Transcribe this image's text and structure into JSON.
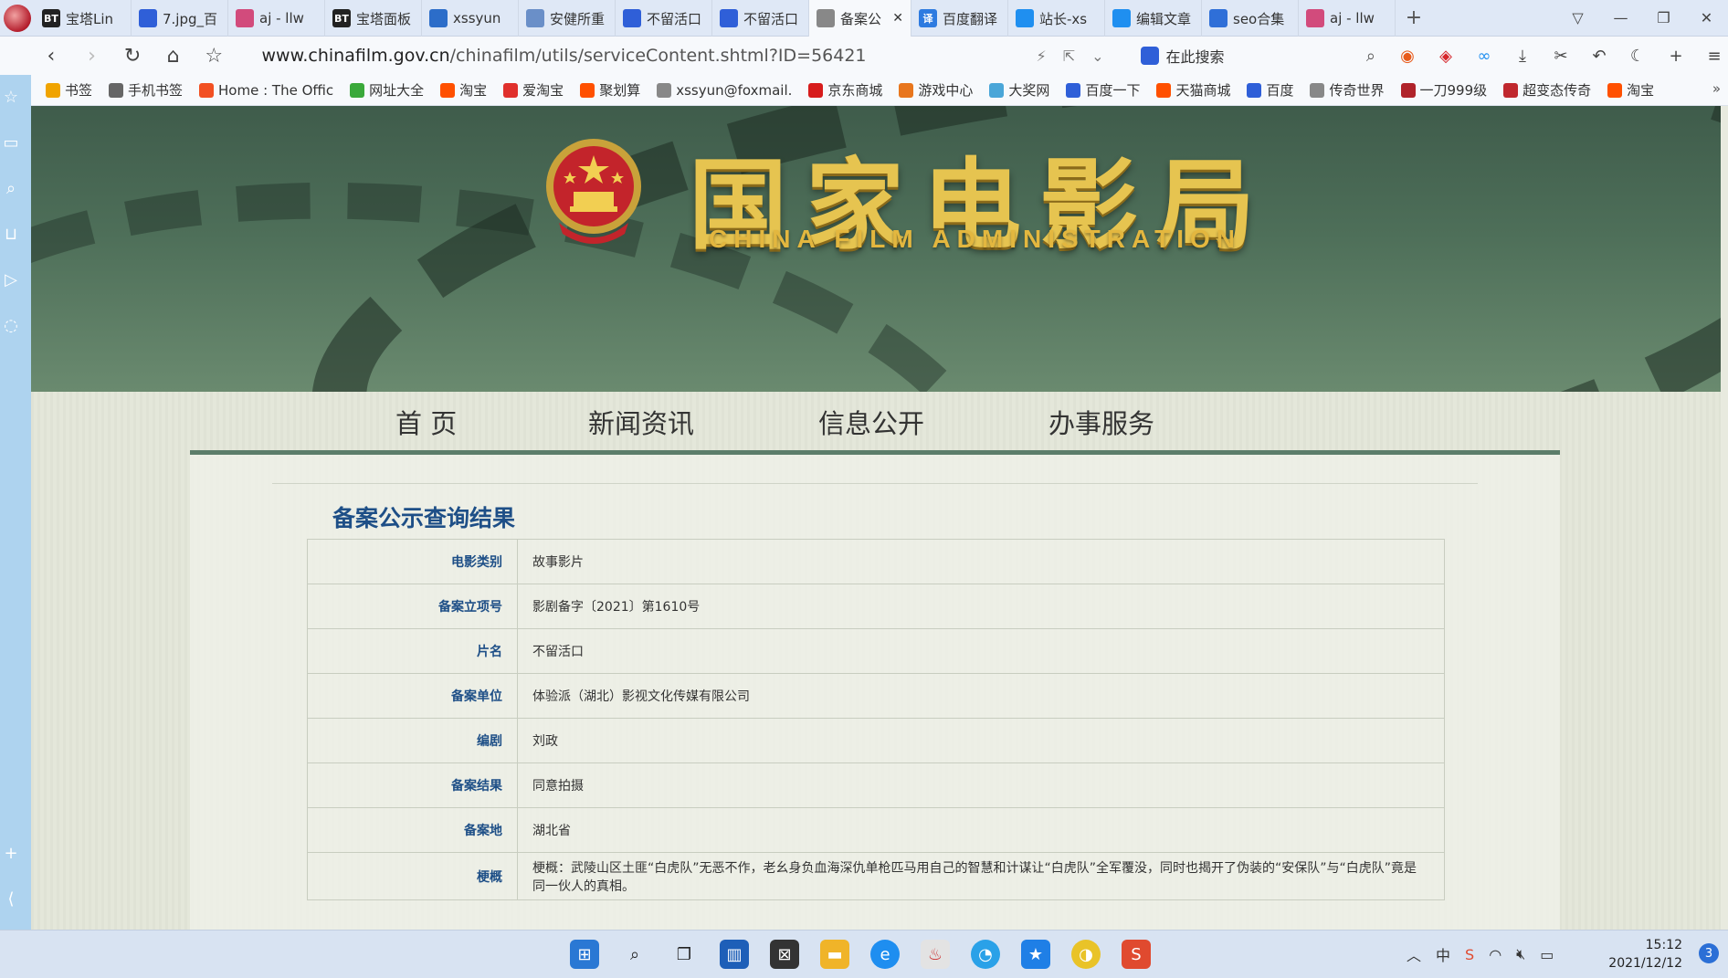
{
  "tabs": [
    {
      "label": "宝塔Lin",
      "icon": "bt-icon",
      "icon_text": "BT",
      "color": "#222222"
    },
    {
      "label": "7.jpg_百",
      "icon": "baidu-paw-icon",
      "icon_text": "",
      "color": "#2f5fd8"
    },
    {
      "label": "aj - llw",
      "icon": "colorful-a-icon",
      "icon_text": "",
      "color": "#d24b7c"
    },
    {
      "label": "宝塔面板",
      "icon": "bt-icon",
      "icon_text": "BT",
      "color": "#222222"
    },
    {
      "label": "xssyun",
      "icon": "w-icon",
      "icon_text": "",
      "color": "#2c6dc9"
    },
    {
      "label": "安健所重",
      "icon": "doc-icon",
      "icon_text": "",
      "color": "#6a8fc8"
    },
    {
      "label": "不留活口",
      "icon": "baidu-paw-icon",
      "icon_text": "",
      "color": "#2f5fd8"
    },
    {
      "label": "不留活口",
      "icon": "baidu-paw-icon",
      "icon_text": "",
      "color": "#2f5fd8"
    },
    {
      "label": "备案公",
      "icon": "globe-icon",
      "icon_text": "",
      "color": "#888888",
      "active": true
    },
    {
      "label": "百度翻译",
      "icon": "translate-icon",
      "icon_text": "译",
      "color": "#2e7be0"
    },
    {
      "label": "站长-xs",
      "icon": "blue-square-icon",
      "icon_text": "",
      "color": "#1f8ff0"
    },
    {
      "label": "编辑文章",
      "icon": "blue-square-icon",
      "icon_text": "",
      "color": "#1f8ff0"
    },
    {
      "label": "seo合集",
      "icon": "seo-icon",
      "icon_text": "",
      "color": "#2f6fd8"
    },
    {
      "label": "aj - llw",
      "icon": "colorful-a-icon",
      "icon_text": "",
      "color": "#d24b7c"
    }
  ],
  "address": {
    "host": "www.chinafilm.gov.cn",
    "path": "/chinafilm/utils/serviceContent.shtml?ID=56421",
    "search_placeholder": "在此搜索"
  },
  "bookmarks": [
    {
      "label": "书签",
      "icon": "star-icon",
      "color": "#f0a400"
    },
    {
      "label": "手机书签",
      "icon": "phone-icon",
      "color": "#666666"
    },
    {
      "label": "Home : The Offic",
      "icon": "microsoft-icon",
      "color": "#f25022"
    },
    {
      "label": "网址大全",
      "icon": "hao-icon",
      "color": "#3aa93a"
    },
    {
      "label": "淘宝",
      "icon": "taobao-icon",
      "color": "#ff5000"
    },
    {
      "label": "爱淘宝",
      "icon": "taobao-icon",
      "color": "#e0302c"
    },
    {
      "label": "聚划算",
      "icon": "taobao-icon",
      "color": "#ff5000"
    },
    {
      "label": "xssyun@foxmail.",
      "icon": "globe-icon",
      "color": "#888888"
    },
    {
      "label": "京东商城",
      "icon": "jd-icon",
      "color": "#d71c1c"
    },
    {
      "label": "游戏中心",
      "icon": "gamepad-icon",
      "color": "#e8761d"
    },
    {
      "label": "大奖网",
      "icon": "star-icon",
      "color": "#4aa6d8"
    },
    {
      "label": "百度一下",
      "icon": "baidu-paw-icon",
      "color": "#2f5fd8"
    },
    {
      "label": "天猫商城",
      "icon": "taobao-icon",
      "color": "#ff5000"
    },
    {
      "label": "百度",
      "icon": "baidu-paw-icon",
      "color": "#2f5fd8"
    },
    {
      "label": "传奇世界",
      "icon": "globe-icon",
      "color": "#888888"
    },
    {
      "label": "一刀999级",
      "icon": "game-icon",
      "color": "#b0232a"
    },
    {
      "label": "超变态传奇",
      "icon": "game-icon",
      "color": "#c0282e"
    },
    {
      "label": "淘宝",
      "icon": "taobao-icon",
      "color": "#ff5000"
    }
  ],
  "banner": {
    "title": "国家电影局",
    "subtitle": "CHINA FILM ADMINISTRATION"
  },
  "main_nav": [
    "首 页",
    "新闻资讯",
    "信息公开",
    "办事服务"
  ],
  "result": {
    "title": "备案公示查询结果",
    "rows": [
      {
        "key": "电影类别",
        "value": "故事影片"
      },
      {
        "key": "备案立项号",
        "value": "影剧备字〔2021〕第1610号"
      },
      {
        "key": "片名",
        "value": "不留活口"
      },
      {
        "key": "备案单位",
        "value": "体验派（湖北）影视文化传媒有限公司"
      },
      {
        "key": "编剧",
        "value": "刘政"
      },
      {
        "key": "备案结果",
        "value": "同意拍摄"
      },
      {
        "key": "备案地",
        "value": "湖北省"
      },
      {
        "key": "梗概",
        "value": "梗概：武陵山区土匪“白虎队”无恶不作，老幺身负血海深仇单枪匹马用自己的智慧和计谋让“白虎队”全军覆没，同时也揭开了伪装的“安保队”与“白虎队”竟是同一伙人的真相。"
      }
    ]
  },
  "taskbar": {
    "time": "15:12",
    "date": "2021/12/12",
    "notifications": "3"
  },
  "colors": {
    "accent": "#1e4f87",
    "banner_green": "#4e6f59",
    "nav_underline": "#5c7d6a",
    "gold": "#e6c450"
  }
}
